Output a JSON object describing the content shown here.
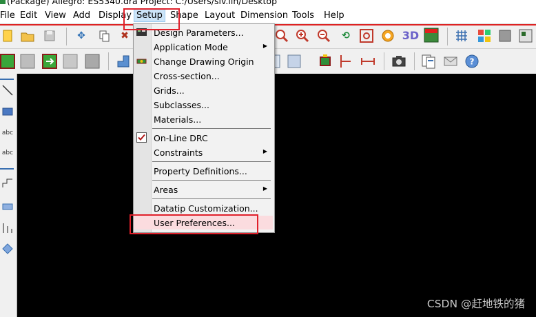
{
  "window": {
    "title": "(Package) Allegro: ES5340.dra  Project: C:/Users/siv.lin/Desktop"
  },
  "menubar": {
    "items": [
      "File",
      "Edit",
      "View",
      "Add",
      "Display",
      "Setup",
      "Shape",
      "Layout",
      "Dimension",
      "Tools",
      "Help"
    ],
    "active": "Setup"
  },
  "toolbar_icons": {
    "row1": [
      "new-file",
      "open-folder",
      "save",
      "move",
      "copy",
      "delete",
      "zoom-in",
      "zoom-in-alt",
      "zoom-out",
      "zoom-previous",
      "zoom-fit",
      "redraw",
      "3d-view",
      "flip",
      "grid",
      "color"
    ],
    "row2": [
      "layer-top",
      "layer-inner",
      "layer-bottom",
      "layer-mask",
      "layer-all",
      "step",
      "component",
      "measure-vertical",
      "measure-horizontal",
      "camera",
      "reports",
      "mail",
      "help"
    ]
  },
  "setup_menu": {
    "items": [
      {
        "label": "Design Parameters...",
        "icon": "design-params-icon"
      },
      {
        "label": "Application Mode",
        "submenu": true
      },
      {
        "label": "Change Drawing Origin",
        "icon": "origin-icon"
      },
      {
        "label": "Cross-section..."
      },
      {
        "label": "Grids..."
      },
      {
        "label": "Subclasses..."
      },
      {
        "label": "Materials..."
      },
      {
        "label": "On-Line DRC",
        "checked": true
      },
      {
        "label": "Constraints",
        "submenu": true
      },
      {
        "label": "Property Definitions..."
      },
      {
        "label": "Areas",
        "submenu": true
      },
      {
        "label": "Datatip Customization..."
      },
      {
        "label": "User Preferences...",
        "highlighted": true
      }
    ]
  },
  "colors": {
    "canvas": "#000000",
    "highlight_box": "#e0202a",
    "menu_hover": "#fbdcdf"
  },
  "watermark": "CSDN @赶地铁的猪"
}
